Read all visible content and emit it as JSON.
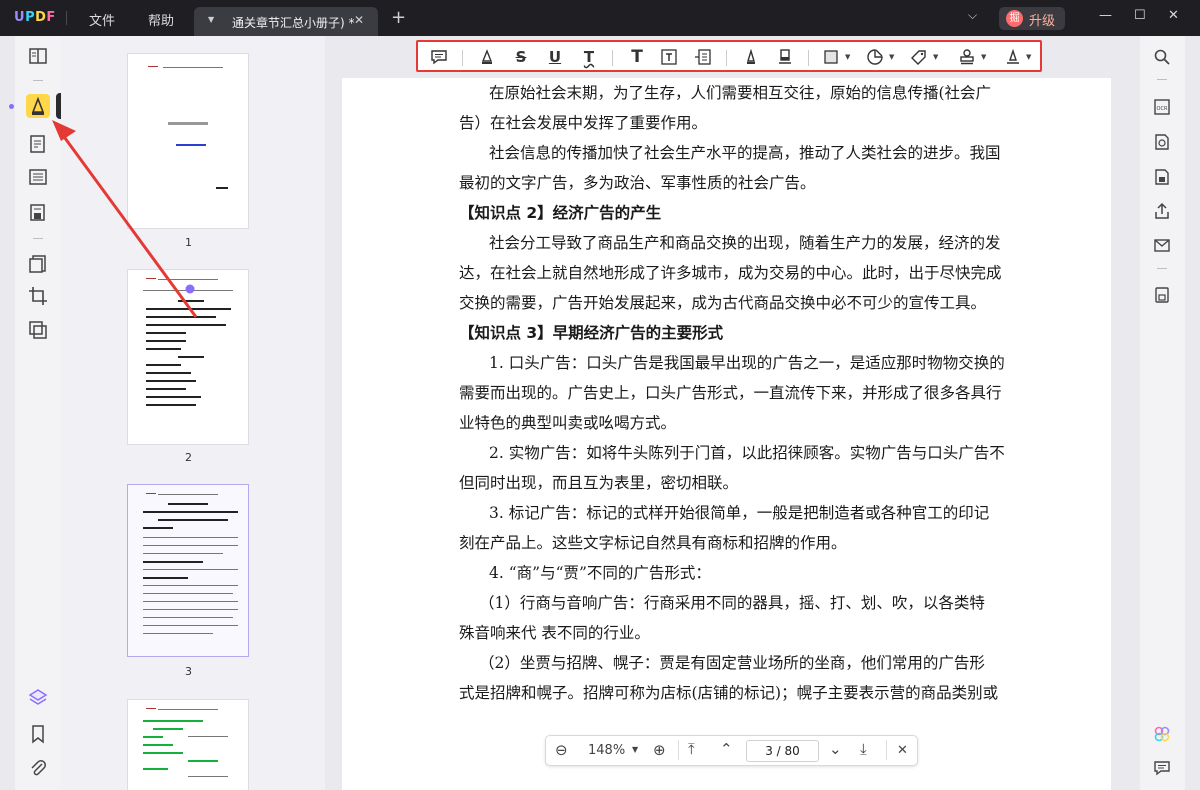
{
  "app": {
    "logo": "UPDF",
    "menus": [
      "文件",
      "帮助"
    ],
    "tab_title": "通关章节汇总小册子)",
    "tab_modified": "*",
    "upgrade_badge": "掘",
    "upgrade_label": "升级"
  },
  "tooltip": "注释",
  "thumbnails": [
    {
      "number": "1"
    },
    {
      "number": "2"
    },
    {
      "number": "3"
    }
  ],
  "document": {
    "paragraphs": [
      "在原始社会末期，为了生存，人们需要相互交往，原始的信息传播(社会广",
      "告）在社会发展中发挥了重要作用。",
      "社会信息的传播加快了社会生产水平的提高，推动了人类社会的进步。我国",
      "最初的文字广告，多为政治、军事性质的社会广告。",
      "【知识点 2】经济广告的产生",
      "社会分工导致了商品生产和商品交换的出现，随着生产力的发展，经济的发",
      "达，在社会上就自然地形成了许多城市，成为交易的中心。此时，出于尽快完成",
      "交换的需要，广告开始发展起来，成为古代商品交换中必不可少的宣传工具。",
      "【知识点 3】早期经济广告的主要形式",
      "1. 口头广告：口头广告是我国最早出现的广告之一，是适应那时物物交换的",
      "需要而出现的。广告史上，口头广告形式，一直流传下来，并形成了很多各具行",
      "业特色的典型叫卖或吆喝方式。",
      "2. 实物广告：如将牛头陈列于门首，以此招徕顾客。实物广告与口头广告不",
      "但同时出现，而且互为表里，密切相联。",
      "3.  标记广告：标记的式样开始很简单，一般是把制造者或各种官工的印记",
      "刻在产品上。这些文字标记自然具有商标和招牌的作用。",
      "4.  “商”与“贾”不同的广告形式：",
      "（1）行商与音响广告：行商采用不同的器具，摇、打、划、吹，以各类特",
      "殊音响来代  表不同的行业。",
      "（2）坐贾与招牌、幌子：贾是有固定营业场所的坐商，他们常用的广告形",
      "式是招牌和幌子。招牌可称为店标(店铺的标记)；幌子主要表示营的商品类别或"
    ]
  },
  "navbar": {
    "zoom": "148%",
    "current_page": "3",
    "separator": "/",
    "total_pages": "80"
  },
  "colors": {
    "annotation_highlight": "#e53935",
    "accent": "#8a6cff",
    "active_tool": "#ffd84a"
  },
  "icons": {
    "left_rail": [
      "reader-icon",
      "comment-highlight-icon",
      "edit-icon",
      "form-icon",
      "organize-icon",
      "page-tools-icon",
      "crop-icon",
      "convert-icon",
      "layers-icon",
      "bookmark-icon",
      "attachment-icon"
    ],
    "right_rail": [
      "search-icon",
      "ocr-icon",
      "convert-pdf-icon",
      "protect-icon",
      "share-icon",
      "email-icon",
      "save-icon",
      "ai-icon",
      "chat-icon"
    ],
    "annotation_tools": [
      "comment-icon",
      "highlight-pen-icon",
      "strikethrough-icon",
      "underline-icon",
      "squiggly-icon",
      "text-icon",
      "textbox-icon",
      "text-callout-icon",
      "pencil-icon",
      "eraser-icon",
      "shape-icon",
      "sticker-icon",
      "tag-icon",
      "stamp-icon",
      "signature-icon"
    ]
  }
}
